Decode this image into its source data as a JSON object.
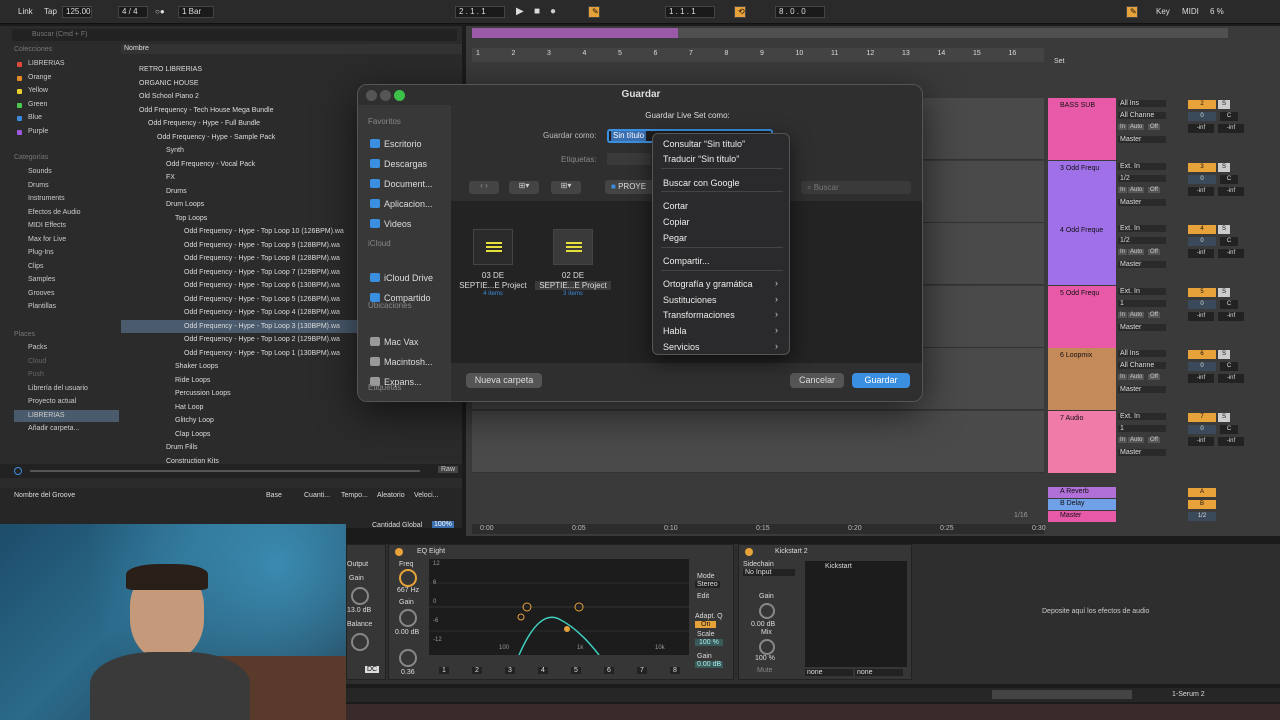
{
  "transport": {
    "link": "Link",
    "tap": "Tap",
    "tempo": "125.00",
    "signature": "4 / 4",
    "quantize": "1 Bar",
    "position": "2 .   1 .   1",
    "loop_start": "1 .   1 .   1",
    "loop_length": "8 .   0 .   0",
    "key": "Key",
    "midi": "MIDI",
    "cpu": "6 %"
  },
  "browser": {
    "search_placeholder": "Buscar (Cmd + F)",
    "collections_title": "Colecciones",
    "collections": [
      {
        "label": "LIBRERIAS",
        "color": "#e04a3a"
      },
      {
        "label": "Orange",
        "color": "#e88a2a"
      },
      {
        "label": "Yellow",
        "color": "#e8d02a"
      },
      {
        "label": "Green",
        "color": "#4ac84a"
      },
      {
        "label": "Blue",
        "color": "#3a8ae0"
      },
      {
        "label": "Purple",
        "color": "#a05ae0"
      }
    ],
    "categories_title": "Categorías",
    "categories": [
      "Sounds",
      "Drums",
      "Instruments",
      "Efectos de Audio",
      "MIDI Effects",
      "Max for Live",
      "Plug-Ins",
      "Clips",
      "Samples",
      "Grooves",
      "Plantillas"
    ],
    "places_title": "Places",
    "places": [
      "Packs",
      "Cloud",
      "Push",
      "Librería del usuario",
      "Proyecto actual",
      "LIBRERIAS",
      "Añadir carpeta..."
    ],
    "tree_header": "Nombre",
    "tree": [
      {
        "label": "RETRO LIBRERIAS",
        "indent": 0
      },
      {
        "label": "ORGANIC HOUSE",
        "indent": 0
      },
      {
        "label": "Old School Piano 2",
        "indent": 0
      },
      {
        "label": "Odd Frequency - Tech House Mega Bundle",
        "indent": 0
      },
      {
        "label": "Odd Frequency - Hype - Full Bundle",
        "indent": 1
      },
      {
        "label": "Odd Frequency - Hype - Sample Pack",
        "indent": 2
      },
      {
        "label": "Synth",
        "indent": 3
      },
      {
        "label": "Odd Frequency - Vocal Pack",
        "indent": 3
      },
      {
        "label": "FX",
        "indent": 3
      },
      {
        "label": "Drums",
        "indent": 3
      },
      {
        "label": "Drum Loops",
        "indent": 3
      },
      {
        "label": "Top Loops",
        "indent": 4
      },
      {
        "label": "Odd Frequency - Hype - Top Loop 10 (126BPM).wa",
        "indent": 5
      },
      {
        "label": "Odd Frequency - Hype - Top Loop 9 (128BPM).wa",
        "indent": 5
      },
      {
        "label": "Odd Frequency - Hype - Top Loop 8 (128BPM).wa",
        "indent": 5
      },
      {
        "label": "Odd Frequency - Hype - Top Loop 7 (129BPM).wa",
        "indent": 5
      },
      {
        "label": "Odd Frequency - Hype - Top Loop 6 (130BPM).wa",
        "indent": 5
      },
      {
        "label": "Odd Frequency - Hype - Top Loop 5 (126BPM).wa",
        "indent": 5
      },
      {
        "label": "Odd Frequency - Hype - Top Loop 4 (128BPM).wa",
        "indent": 5
      },
      {
        "label": "Odd Frequency - Hype - Top Loop 3 (130BPM).wa",
        "indent": 5
      },
      {
        "label": "Odd Frequency - Hype - Top Loop 2 (129BPM).wa",
        "indent": 5
      },
      {
        "label": "Odd Frequency - Hype - Top Loop 1 (130BPM).wa",
        "indent": 5
      },
      {
        "label": "Shaker Loops",
        "indent": 4
      },
      {
        "label": "Ride Loops",
        "indent": 4
      },
      {
        "label": "Percussion Loops",
        "indent": 4
      },
      {
        "label": "Hat Loop",
        "indent": 4
      },
      {
        "label": "Glitchy Loop",
        "indent": 4
      },
      {
        "label": "Clap Loops",
        "indent": 4
      },
      {
        "label": "Drum Fills",
        "indent": 3
      },
      {
        "label": "Construction Kits",
        "indent": 3
      }
    ],
    "raw": "Raw",
    "groove_cols": [
      "Nombre del Groove",
      "Base",
      "Cuanti...",
      "Tempo...",
      "Aleatorio",
      "Veloci..."
    ],
    "global_amount_label": "Cantidad Global",
    "global_amount": "100%"
  },
  "arrangement": {
    "ruler": [
      "1",
      "2",
      "3",
      "4",
      "5",
      "6",
      "7",
      "8",
      "9",
      "10",
      "11",
      "12",
      "13",
      "14",
      "15",
      "16"
    ],
    "set_label": "Set",
    "time_ruler": [
      "0:00",
      "0:05",
      "0:10",
      "0:15",
      "0:20",
      "0:25",
      "0:30"
    ],
    "tracks": [
      {
        "name": "BASS SUB",
        "color": "#e85aa8",
        "input": "All Ins",
        "chan": "All Channe",
        "out": "Master",
        "num": "2"
      },
      {
        "name": "3 Odd Frequ",
        "color": "#a070e8",
        "input": "Ext. In",
        "chan": "1/2",
        "out": "Master",
        "num": "3"
      },
      {
        "name": "4 Odd Freque",
        "color": "#a070e8",
        "input": "Ext. In",
        "chan": "1/2",
        "out": "Master",
        "num": "4"
      },
      {
        "name": "5 Odd Frequ",
        "color": "#e85aa8",
        "input": "Ext. In",
        "chan": "1",
        "out": "Master",
        "num": "5"
      },
      {
        "name": "6 Loopmix",
        "color": "#c48a5a",
        "input": "All Ins",
        "chan": "All Channe",
        "out": "Master",
        "num": "6"
      },
      {
        "name": "7 Audio",
        "color": "#f07aa8",
        "input": "Ext. In",
        "chan": "1",
        "out": "Master",
        "num": "7"
      }
    ],
    "returns": [
      {
        "name": "A Reverb",
        "color": "#b070d8",
        "num": "A"
      },
      {
        "name": "B Delay",
        "color": "#70a0e8",
        "num": "B"
      },
      {
        "name": "Master",
        "color": "#e85aa8",
        "num": "1/2"
      }
    ],
    "mix_labels": {
      "in": "In",
      "auto": "Auto",
      "off": "Off",
      "inf": "-inf",
      "zero": "0",
      "c": "C",
      "s": "S",
      "post": "Post"
    },
    "page_indicator": "1/16"
  },
  "devices": {
    "eq_title": "EQ Eight",
    "freq_label": "Freq",
    "freq_value": "667 Hz",
    "gain_label": "Gain",
    "gain_value": "0.00 dB",
    "q_value": "0.36",
    "output_label": "Output",
    "output_gain": "13.0 dB",
    "balance": "Balance",
    "mode_label": "Mode",
    "mode_value": "Stereo",
    "edit_label": "Edit",
    "adapt_q": "Adapt. Q",
    "adapt_q_value": "On",
    "scale_label": "Scale",
    "scale_value": "100 %",
    "gain2_value": "0.00 dB",
    "eq_y_ticks": [
      "12",
      "6",
      "0",
      "-6",
      "-12"
    ],
    "eq_x_ticks": [
      "100",
      "1k",
      "10k"
    ],
    "bands": [
      "1",
      "2",
      "3",
      "4",
      "5",
      "6",
      "7",
      "8"
    ],
    "kick_title": "Kickstart 2",
    "sidechain": "Sidechain",
    "no_input": "No Input",
    "kick_gain": "Gain",
    "kick_gain_value": "0.00 dB",
    "kick_mix": "Mix",
    "kick_mix_value": "100 %",
    "mute": "Mute",
    "kickstart_label": "Kickstart",
    "none": "none",
    "drop_hint": "Deposite aquí los efectos de audio",
    "status_right": "1-Serum 2"
  },
  "dialog": {
    "title": "Guardar",
    "favorites": "Favoritos",
    "fav_items": [
      "Escritorio",
      "Descargas",
      "Document...",
      "Aplicacion...",
      "Videos"
    ],
    "icloud": "iCloud",
    "icloud_items": [
      "iCloud Drive",
      "Compartido"
    ],
    "locations": "Ubicaciones",
    "loc_items": [
      "Mac Vax",
      "Macintosh...",
      "Expans..."
    ],
    "tags": "Etiquetas",
    "header": "Guardar Live Set como:",
    "save_as_label": "Guardar como:",
    "save_as_value": "Sin título",
    "tags_label": "Etiquetas:",
    "folder": "PROYE",
    "search_placeholder": "Buscar",
    "files": [
      {
        "line1": "03 DE",
        "line2": "SEPTIE...E Project",
        "meta": "4 ítems"
      },
      {
        "line1": "02 DE",
        "line2": "SEPTIE...E Project",
        "meta": "3 ítems"
      }
    ],
    "new_folder": "Nueva carpeta",
    "cancel": "Cancelar",
    "save": "Guardar"
  },
  "context_menu": {
    "items": [
      {
        "label": "Consultar “Sin título”",
        "sub": false
      },
      {
        "label": "Traducir “Sin título”",
        "sub": false
      },
      {
        "label": "Buscar con Google",
        "sub": false
      },
      {
        "label": "Cortar",
        "sub": false
      },
      {
        "label": "Copiar",
        "sub": false
      },
      {
        "label": "Pegar",
        "sub": false
      },
      {
        "label": "Compartir...",
        "sub": false
      },
      {
        "label": "Ortografía y gramática",
        "sub": true
      },
      {
        "label": "Sustituciones",
        "sub": true
      },
      {
        "label": "Transformaciones",
        "sub": true
      },
      {
        "label": "Habla",
        "sub": true
      },
      {
        "label": "Servicios",
        "sub": true
      }
    ]
  },
  "colors": {
    "accent": "#3b8fe0",
    "orange": "#e8a23a",
    "ableton_bg": "#3a3a3a"
  }
}
